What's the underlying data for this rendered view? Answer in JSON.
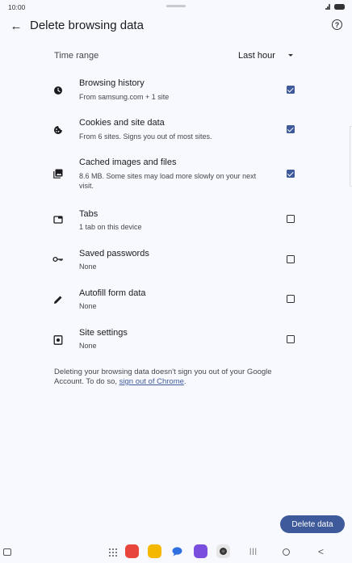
{
  "status_bar": {
    "time": "10:00"
  },
  "header": {
    "back_glyph": "←",
    "title": "Delete browsing data",
    "help_glyph": "?"
  },
  "time_range": {
    "label": "Time range",
    "value": "Last hour"
  },
  "options": [
    {
      "title": "Browsing history",
      "subtitle": "From samsung.com + 1 site",
      "checked": true,
      "icon": "clock-icon"
    },
    {
      "title": "Cookies and site data",
      "subtitle": "From 6 sites. Signs you out of most sites.",
      "checked": true,
      "icon": "cookie-icon"
    },
    {
      "title": "Cached images and files",
      "subtitle": "8.6 MB. Some sites may load more slowly on your next visit.",
      "checked": true,
      "icon": "image-icon"
    },
    {
      "title": "Tabs",
      "subtitle": "1 tab on this device",
      "checked": false,
      "icon": "tab-icon"
    },
    {
      "title": "Saved passwords",
      "subtitle": "None",
      "checked": false,
      "icon": "key-icon"
    },
    {
      "title": "Autofill form data",
      "subtitle": "None",
      "checked": false,
      "icon": "pencil-icon"
    },
    {
      "title": "Site settings",
      "subtitle": "None",
      "checked": false,
      "icon": "site-settings-icon"
    }
  ],
  "footer": {
    "text": "Deleting your browsing data doesn't sign you out of your Google Account. To do so, ",
    "link": "sign out of Chrome",
    "end": "."
  },
  "actions": {
    "delete_label": "Delete data"
  },
  "nav_bar": {
    "recents_glyph": "|||",
    "back_glyph": "<"
  },
  "colors": {
    "accent": "#3f5a9a",
    "background": "#f8f9ff",
    "text": "#1b1b1f",
    "secondary_text": "#44474f"
  }
}
